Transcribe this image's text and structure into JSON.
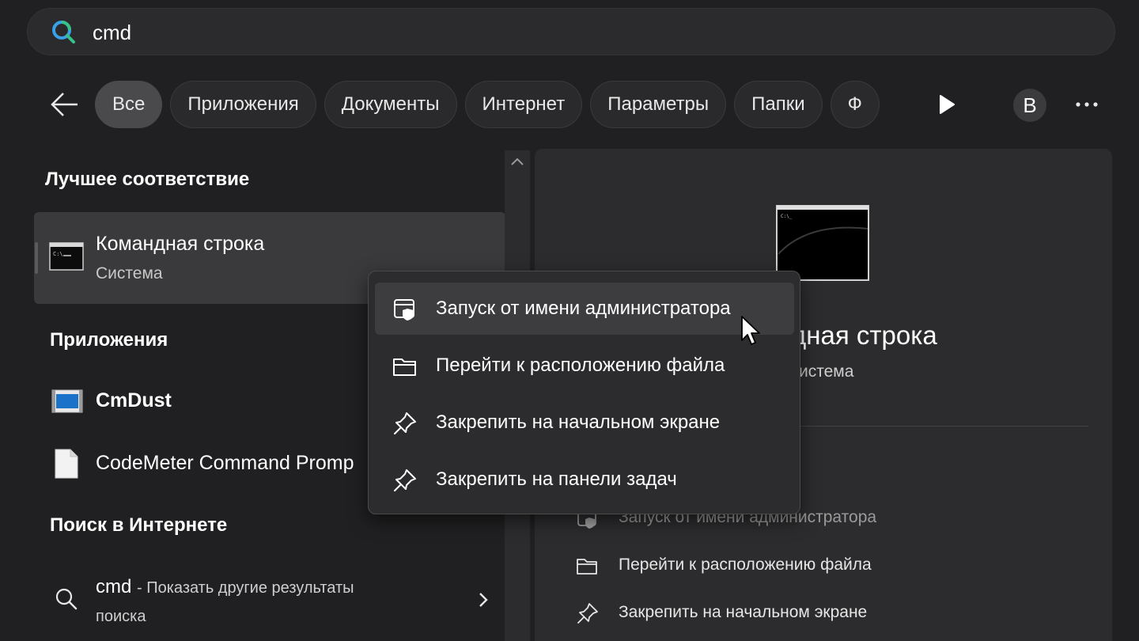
{
  "search": {
    "query": "cmd"
  },
  "filters": {
    "tabs": [
      "Все",
      "Приложения",
      "Документы",
      "Интернет",
      "Параметры",
      "Папки",
      "Ф"
    ],
    "active_index": 0,
    "avatar_letter": "B"
  },
  "best_match": {
    "heading": "Лучшее соответствие",
    "title": "Командная строка",
    "subtitle": "Система"
  },
  "apps": {
    "heading": "Приложения",
    "items": [
      {
        "label": "CmDust",
        "icon": "app-window-icon"
      },
      {
        "label": "CodeMeter Command Promp",
        "icon": "document-icon"
      }
    ]
  },
  "web": {
    "heading": "Поиск в Интернете",
    "query": "cmd",
    "suffix": "- Показать другие результаты",
    "suffix2": "поиска"
  },
  "preview": {
    "title": "дная строка",
    "subtitle": "истема",
    "actions": [
      {
        "label": "Запуск от имени администратора",
        "icon": "shield-window-icon"
      },
      {
        "label": "Перейти к расположению файла",
        "icon": "folder-icon"
      },
      {
        "label": "Закрепить на начальном экране",
        "icon": "pin-icon"
      }
    ]
  },
  "context_menu": {
    "items": [
      {
        "label": "Запуск от имени администратора",
        "icon": "shield-window-icon"
      },
      {
        "label": "Перейти к расположению файла",
        "icon": "folder-icon"
      },
      {
        "label": "Закрепить на начальном экране",
        "icon": "pin-icon"
      },
      {
        "label": "Закрепить на панели задач",
        "icon": "pin-icon"
      }
    ],
    "hovered_index": 0
  },
  "colors": {
    "background": "#202022",
    "panel": "#2c2c2e",
    "highlight": "#3a3a3c",
    "search_icon_blue": "#3aa0e8",
    "search_icon_green": "#36c38a"
  }
}
